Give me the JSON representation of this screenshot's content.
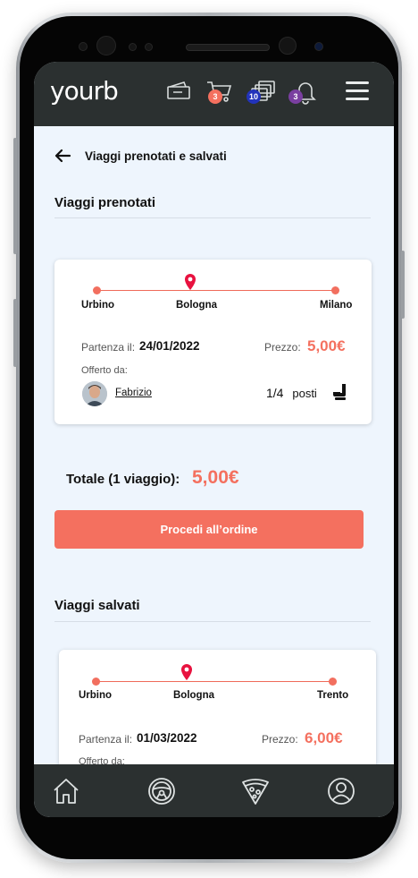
{
  "header": {
    "logo": "yourb",
    "cart_badge": "3",
    "messages_badge": "10",
    "notifications_badge": "3",
    "colors": {
      "bar": "#2b3030",
      "cart_badge": "#f4705f",
      "messages_badge": "#2233bb",
      "notifications_badge": "#7a3fa0"
    }
  },
  "page": {
    "back_title": "Viaggi prenotati e salvati"
  },
  "booked": {
    "section_title": "Viaggi prenotati",
    "trip": {
      "from": "Urbino",
      "via": "Bologna",
      "to": "Milano",
      "departure_label": "Partenza il:",
      "departure_date": "24/01/2022",
      "price_label": "Prezzo:",
      "price": "5,00€",
      "offered_by_label": "Offerto da:",
      "driver": "Fabrizio",
      "seats": "1/4",
      "seats_label": "posti"
    }
  },
  "summary": {
    "total_label": "Totale (1 viaggio):",
    "total_value": "5,00€",
    "cta_label": "Procedi all’ordine"
  },
  "saved": {
    "section_title": "Viaggi salvati",
    "trip": {
      "from": "Urbino",
      "via": "Bologna",
      "to": "Trento",
      "departure_label": "Partenza il:",
      "departure_date": "01/03/2022",
      "price_label": "Prezzo:",
      "price": "6,00€",
      "offered_by_label": "Offerto da:"
    }
  },
  "nav": {
    "items": [
      "home-icon",
      "steering-wheel-icon",
      "pizza-icon",
      "user-icon"
    ]
  },
  "accent_color": "#f4705f",
  "pin_color": "#e8123f"
}
